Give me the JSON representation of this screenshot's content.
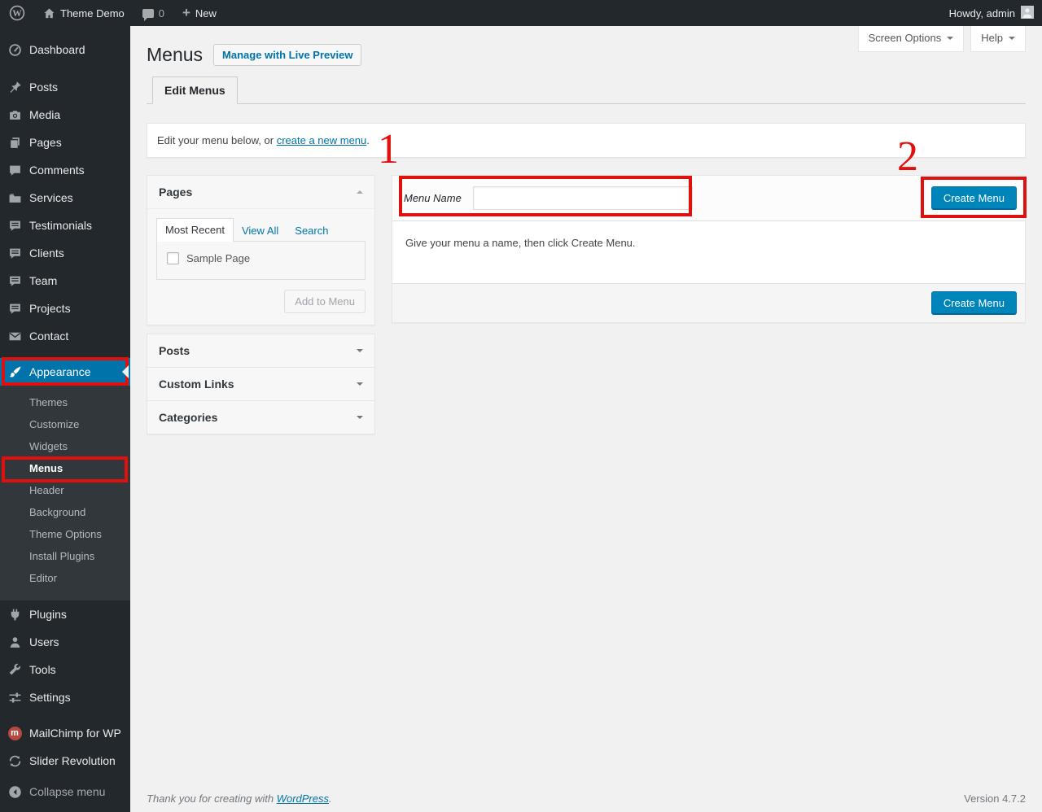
{
  "colors": {
    "accent": "#0073aa",
    "primary": "#0085ba",
    "annotation": "#e0100f",
    "adminbar": "#23282d",
    "submenu": "#32373c",
    "pagebg": "#f1f1f1"
  },
  "admin_bar": {
    "site_name": "Theme Demo",
    "comment_count": "0",
    "new_label": "New",
    "howdy": "Howdy, admin"
  },
  "screen_meta": {
    "screen_options": "Screen Options",
    "help": "Help"
  },
  "sidebar": {
    "top": [
      {
        "label": "Dashboard"
      },
      {
        "label": "Posts"
      },
      {
        "label": "Media"
      },
      {
        "label": "Pages"
      },
      {
        "label": "Comments"
      },
      {
        "label": "Services"
      },
      {
        "label": "Testimonials"
      },
      {
        "label": "Clients"
      },
      {
        "label": "Team"
      },
      {
        "label": "Projects"
      },
      {
        "label": "Contact"
      }
    ],
    "appearance": {
      "label": "Appearance",
      "submenu": [
        {
          "label": "Themes"
        },
        {
          "label": "Customize"
        },
        {
          "label": "Widgets"
        },
        {
          "label": "Menus"
        },
        {
          "label": "Header"
        },
        {
          "label": "Background"
        },
        {
          "label": "Theme Options"
        },
        {
          "label": "Install Plugins"
        },
        {
          "label": "Editor"
        }
      ]
    },
    "bottom": [
      {
        "label": "Plugins"
      },
      {
        "label": "Users"
      },
      {
        "label": "Tools"
      },
      {
        "label": "Settings"
      }
    ],
    "plugins_extra": [
      {
        "label": "MailChimp for WP"
      },
      {
        "label": "Slider Revolution"
      }
    ],
    "collapse": "Collapse menu"
  },
  "page": {
    "title": "Menus",
    "live_preview_button": "Manage with Live Preview",
    "tab": "Edit Menus",
    "intro_prefix": "Edit your menu below, or ",
    "intro_link": "create a new menu",
    "intro_suffix": "."
  },
  "annotations": {
    "step1": "1",
    "step2": "2"
  },
  "meta_boxes": {
    "pages": {
      "title": "Pages",
      "tab_most_recent": "Most Recent",
      "tab_view_all": "View All",
      "tab_search": "Search",
      "item_label": "Sample Page",
      "add_button": "Add to Menu"
    },
    "posts": {
      "title": "Posts"
    },
    "custom_links": {
      "title": "Custom Links"
    },
    "categories": {
      "title": "Categories"
    }
  },
  "menu_editor": {
    "name_label": "Menu Name",
    "name_value": "",
    "create_button": "Create Menu",
    "help_text": "Give your menu a name, then click Create Menu.",
    "footer_create_button": "Create Menu"
  },
  "footer": {
    "thanks_prefix": "Thank you for creating with ",
    "thanks_link": "WordPress",
    "thanks_suffix": ".",
    "version": "Version 4.7.2"
  }
}
